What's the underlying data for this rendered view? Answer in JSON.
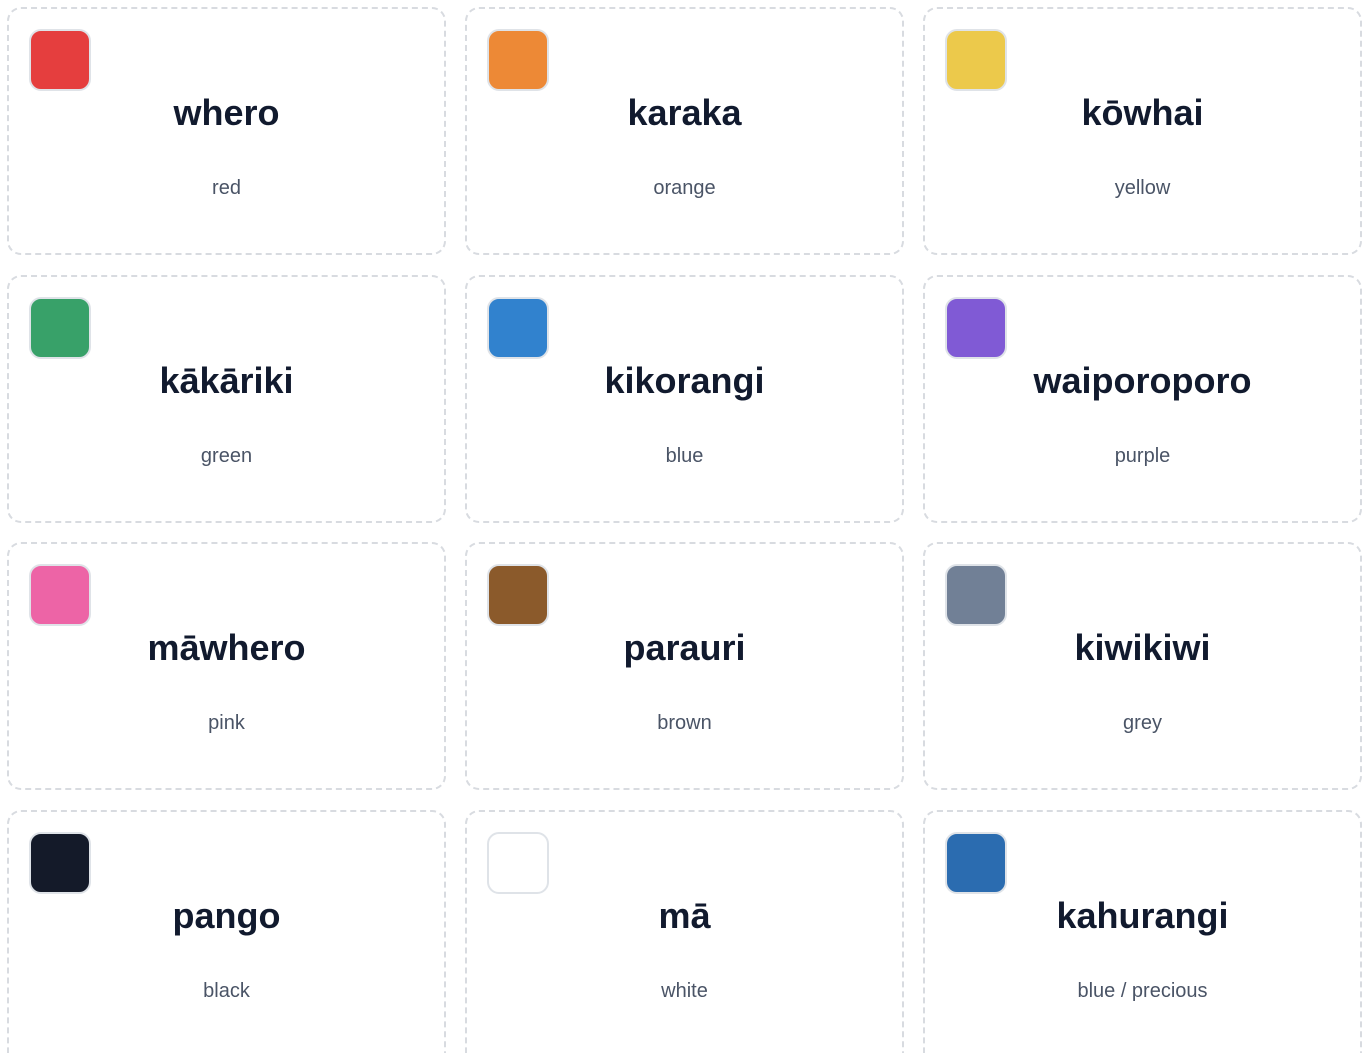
{
  "cards": [
    {
      "word": "whero",
      "meaning": "red",
      "color": "#e53e3e"
    },
    {
      "word": "karaka",
      "meaning": "orange",
      "color": "#ed8936"
    },
    {
      "word": "kōwhai",
      "meaning": "yellow",
      "color": "#ecc94b"
    },
    {
      "word": "kākāriki",
      "meaning": "green",
      "color": "#38a169"
    },
    {
      "word": "kikorangi",
      "meaning": "blue",
      "color": "#3182ce"
    },
    {
      "word": "waiporoporo",
      "meaning": "purple",
      "color": "#805ad5"
    },
    {
      "word": "māwhero",
      "meaning": "pink",
      "color": "#ed64a6"
    },
    {
      "word": "parauri",
      "meaning": "brown",
      "color": "#8b5a2b"
    },
    {
      "word": "kiwikiwi",
      "meaning": "grey",
      "color": "#718096"
    },
    {
      "word": "pango",
      "meaning": "black",
      "color": "#141a29"
    },
    {
      "word": "mā",
      "meaning": "white",
      "color": "#ffffff"
    },
    {
      "word": "kahurangi",
      "meaning": "blue / precious",
      "color": "#2b6cb0"
    }
  ]
}
